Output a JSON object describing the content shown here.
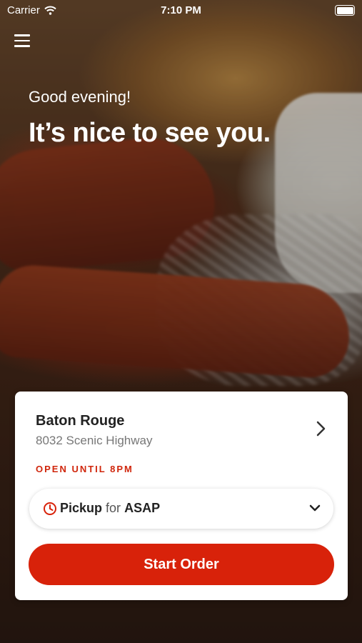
{
  "status_bar": {
    "carrier": "Carrier",
    "time": "7:10 PM"
  },
  "hero": {
    "greeting": "Good evening!",
    "headline": "It’s nice to see you."
  },
  "location": {
    "name": "Baton Rouge",
    "address": "8032 Scenic Highway",
    "hours": "OPEN UNTIL 8PM"
  },
  "order_mode": {
    "mode": "Pickup",
    "connector": "for",
    "time": "ASAP"
  },
  "actions": {
    "start_order": "Start Order"
  },
  "colors": {
    "accent": "#d8220a",
    "hours_text": "#d0260c"
  },
  "icons": {
    "menu": "hamburger-icon",
    "chevron": "chevron-right-icon",
    "clock": "clock-icon",
    "dropdown": "chevron-down-icon"
  }
}
